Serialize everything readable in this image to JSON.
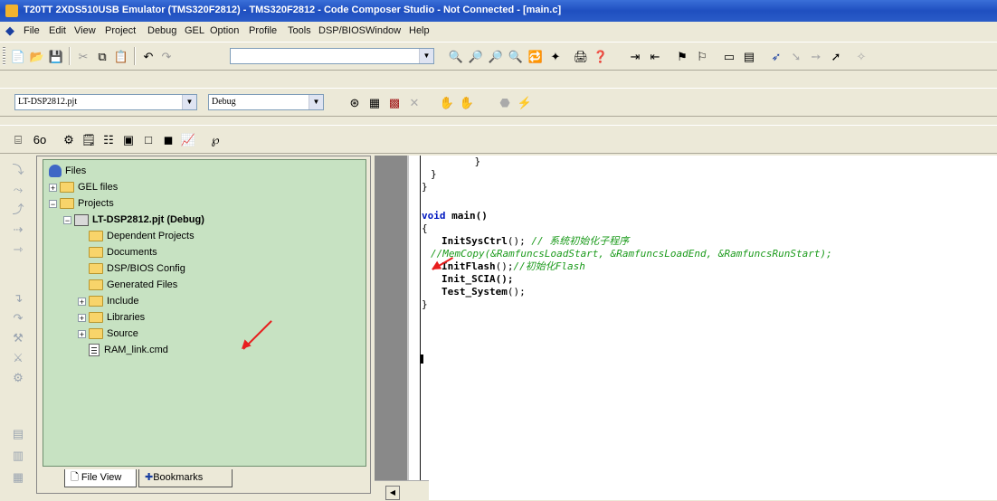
{
  "window": {
    "title": "T20TT 2XDS510USB Emulator (TMS320F2812) - TMS320F2812 - Code Composer Studio - Not Connected - [main.c]"
  },
  "menu": [
    "File",
    "Edit",
    "View",
    "Project",
    "Debug",
    "GEL",
    "Option",
    "Profile",
    "Tools",
    "DSP/BIOS",
    "Window",
    "Help"
  ],
  "toolbar": {
    "project_combo": "LT-DSP2812.pjt",
    "config_combo": "Debug",
    "search_combo": ""
  },
  "tree": {
    "root": "Files",
    "gel": "GEL files",
    "projects": "Projects",
    "project": "LT-DSP2812.pjt (Debug)",
    "dependent": "Dependent Projects",
    "documents": "Documents",
    "bios": "DSP/BIOS Config",
    "generated": "Generated Files",
    "include": "Include",
    "libraries": "Libraries",
    "source": "Source",
    "cmd": "RAM_link.cmd"
  },
  "tabs": {
    "file_view": "File View",
    "bookmarks": "Bookmarks"
  },
  "code": {
    "l1": "  }",
    "l2": "}",
    "l3": "}",
    "main_kw": "void",
    "main_rest": " main()",
    "brace_open": "{",
    "init_sys": "InitSysCtrl",
    "init_sys_tail": "();",
    "init_sys_comment": " // 系统初始化子程序",
    "memcopy_comment": "//MemCopy(&RamfuncsLoadStart, &RamfuncsLoadEnd, &RamfuncsRunStart);",
    "init_flash": "InitFlash",
    "init_flash_tail": "();",
    "init_flash_comment": "//初始化Flash",
    "init_scia": "Init_SCIA();",
    "test_system": "Test_System",
    "test_system_tail": "();",
    "brace_close": "}"
  },
  "colors": {
    "annotation_arrow": "#e81e1e",
    "tree_background": "#c7e2c2",
    "keyword": "#0018c0",
    "comment": "#1a9a1a"
  }
}
